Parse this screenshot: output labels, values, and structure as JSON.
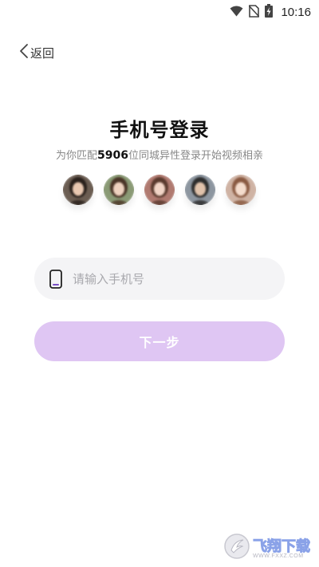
{
  "status_bar": {
    "time": "10:16"
  },
  "nav": {
    "back_label": "返回"
  },
  "header": {
    "title": "手机号登录",
    "subtitle_prefix": "为你匹配",
    "subtitle_count": "5906",
    "subtitle_suffix": "位同城异性登录开始视频相亲"
  },
  "avatars": [
    {
      "name": "avatar-1",
      "bg": "#6b5d52",
      "face": "#e9c8b1",
      "hair": "#2a211c"
    },
    {
      "name": "avatar-2",
      "bg": "#8a9a75",
      "face": "#eed2bf",
      "hair": "#4a3527"
    },
    {
      "name": "avatar-3",
      "bg": "#b07a70",
      "face": "#f1d4c6",
      "hair": "#5a3a2e"
    },
    {
      "name": "avatar-4",
      "bg": "#8d96a0",
      "face": "#e0c2ab",
      "hair": "#2d2d2d"
    },
    {
      "name": "avatar-5",
      "bg": "#cfb3a4",
      "face": "#f4dccd",
      "hair": "#8a5a42"
    }
  ],
  "form": {
    "phone_placeholder": "请输入手机号",
    "next_label": "下一步"
  },
  "watermark": {
    "brand": "飞翔下载",
    "domain": "WWW.FXXZ.COM"
  },
  "colors": {
    "accent": "#dfc6f3",
    "icon_accent": "#7a4fc6",
    "field_bg": "#f4f4f6"
  }
}
